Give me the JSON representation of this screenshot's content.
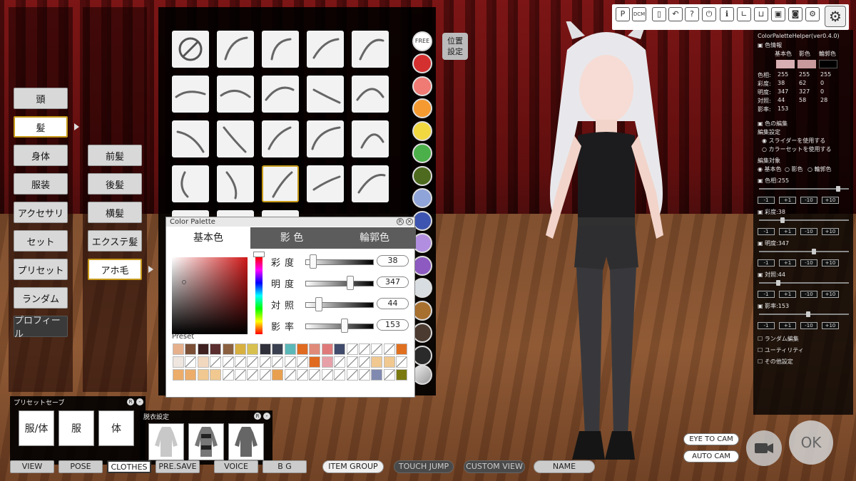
{
  "left_menu": {
    "items": [
      {
        "label": "頭"
      },
      {
        "label": "髪"
      },
      {
        "label": "身体"
      },
      {
        "label": "服装"
      },
      {
        "label": "アクセサリ"
      },
      {
        "label": "セット"
      },
      {
        "label": "プリセット"
      },
      {
        "label": "ランダム"
      },
      {
        "label": "プロフィール"
      }
    ]
  },
  "hair_menu": {
    "items": [
      {
        "label": "前髪"
      },
      {
        "label": "後髪"
      },
      {
        "label": "横髪"
      },
      {
        "label": "エクステ髪"
      },
      {
        "label": "アホ毛"
      }
    ]
  },
  "color_swatches": {
    "free_label": "FREE",
    "colors": [
      "#d43030",
      "#f07a74",
      "#f59a30",
      "#f2d840",
      "#4cb04a",
      "#4d6a1e",
      "#8fa4d8",
      "#3d55b0",
      "#b28ee0",
      "#8c5ac0",
      "#d8dde2",
      "#a8702e",
      "#4a3a30",
      "#2a2a2a"
    ]
  },
  "position_button": {
    "label_line1": "位置",
    "label_line2": "設定"
  },
  "color_palette": {
    "title": "Color Palette",
    "tabs": [
      {
        "label": "基本色"
      },
      {
        "label": "影 色"
      },
      {
        "label": "輪郭色"
      }
    ],
    "sliders": [
      {
        "label": "彩度",
        "value": "38"
      },
      {
        "label": "明度",
        "value": "347"
      },
      {
        "label": "対照",
        "value": "44"
      },
      {
        "label": "影率",
        "value": "153"
      }
    ],
    "preset_label": "Preset",
    "preset_rows": [
      [
        "#e7b08c",
        "#7a4f36",
        "#3e2020",
        "#5a2e2e",
        "#8a6040",
        "#d8b040",
        "#d8c050",
        "#30303a",
        "#3a4050",
        "#5ab8b8",
        "#e06a20",
        "#e08a7a",
        "#e07a7a",
        "#404a6a",
        "",
        "",
        "",
        "",
        "#e07020"
      ],
      [
        "#efe6e0",
        "",
        "#f3d8c0",
        "",
        "",
        "",
        "",
        "",
        "",
        "",
        "",
        "#e06a20",
        "#e8a0a8",
        "",
        "",
        "",
        "#f0c890",
        "#f0c890",
        ""
      ],
      [
        "#ecad6a",
        "#ecad6a",
        "#f0c890",
        "#f0c890",
        "",
        "",
        "",
        "",
        "#e8a050",
        "",
        "",
        "",
        "",
        "",
        "",
        "",
        "#808ab0",
        "",
        "#7a7a10"
      ]
    ]
  },
  "preset_save": {
    "title": "プリセットセーブ",
    "buttons": [
      {
        "label": "服/体"
      },
      {
        "label": "服"
      },
      {
        "label": "体"
      }
    ]
  },
  "undress": {
    "title": "脱衣設定"
  },
  "bottom_bar": {
    "buttons": [
      {
        "label": "VIEW"
      },
      {
        "label": "POSE"
      },
      {
        "label": "CLOTHES"
      },
      {
        "label": "PRE.SAVE"
      },
      {
        "label": "VOICE"
      },
      {
        "label": "B G"
      },
      {
        "label": "ITEM GROUP"
      },
      {
        "label": "TOUCH JUMP"
      },
      {
        "label": "CUSTOM VIEW"
      },
      {
        "label": "NAME"
      }
    ]
  },
  "camera_buttons": {
    "eye_to_cam": "EYE TO CAM",
    "auto_cam": "AUTO CAM",
    "ok": "OK"
  },
  "toolbar": {
    "icons": [
      {
        "name": "p-icon",
        "glyph": "P"
      },
      {
        "name": "dcm-icon",
        "glyph": "DCM"
      },
      {
        "name": "bracket-icon",
        "glyph": "▯"
      },
      {
        "name": "undo-icon",
        "glyph": "↶"
      },
      {
        "name": "help-icon",
        "glyph": "?"
      },
      {
        "name": "power-icon",
        "glyph": "⏻"
      },
      {
        "name": "info-icon",
        "glyph": "ℹ"
      },
      {
        "name": "chart-icon",
        "glyph": "∟"
      },
      {
        "name": "basket-icon",
        "glyph": "⊔"
      },
      {
        "name": "save-icon",
        "glyph": "▣"
      },
      {
        "name": "camera-icon",
        "glyph": "◙"
      },
      {
        "name": "tools-icon",
        "glyph": "⚙"
      }
    ]
  },
  "color_helper": {
    "title": "ColorPaletteHelper(ver0.4.0)",
    "color_info": "色情報",
    "headers": [
      "基本色",
      "影色",
      "輪郭色"
    ],
    "swatches": [
      "#d8b0b4",
      "#c89a9e",
      "#000000"
    ],
    "rows": [
      {
        "label": "色相:",
        "v1": "255",
        "v2": "255",
        "v3": "255"
      },
      {
        "label": "彩度:",
        "v1": "38",
        "v2": "62",
        "v3": "0"
      },
      {
        "label": "明度:",
        "v1": "347",
        "v2": "327",
        "v3": "0"
      },
      {
        "label": "対照:",
        "v1": "44",
        "v2": "58",
        "v3": "28"
      },
      {
        "label": "影率:",
        "v1": "153",
        "v2": "",
        "v3": ""
      }
    ],
    "color_edit": "色の編集",
    "edit_settings": "編集設定",
    "use_slider": "スライダーを使用する",
    "use_colorset": "カラーセットを使用する",
    "edit_target": "編集対象",
    "target_basic": "基本色",
    "target_shadow": "影色",
    "target_outline": "輪郭色",
    "adjust_rows": [
      {
        "label": "色相:255"
      },
      {
        "label": "彩度:38"
      },
      {
        "label": "明度:347"
      },
      {
        "label": "対照:44"
      },
      {
        "label": "影率:153"
      }
    ],
    "step_buttons": [
      "-1",
      "+1",
      "-10",
      "+10"
    ],
    "random_edit": "ランダム編集",
    "utility": "ユーティリティ",
    "other_settings": "その他設定"
  }
}
